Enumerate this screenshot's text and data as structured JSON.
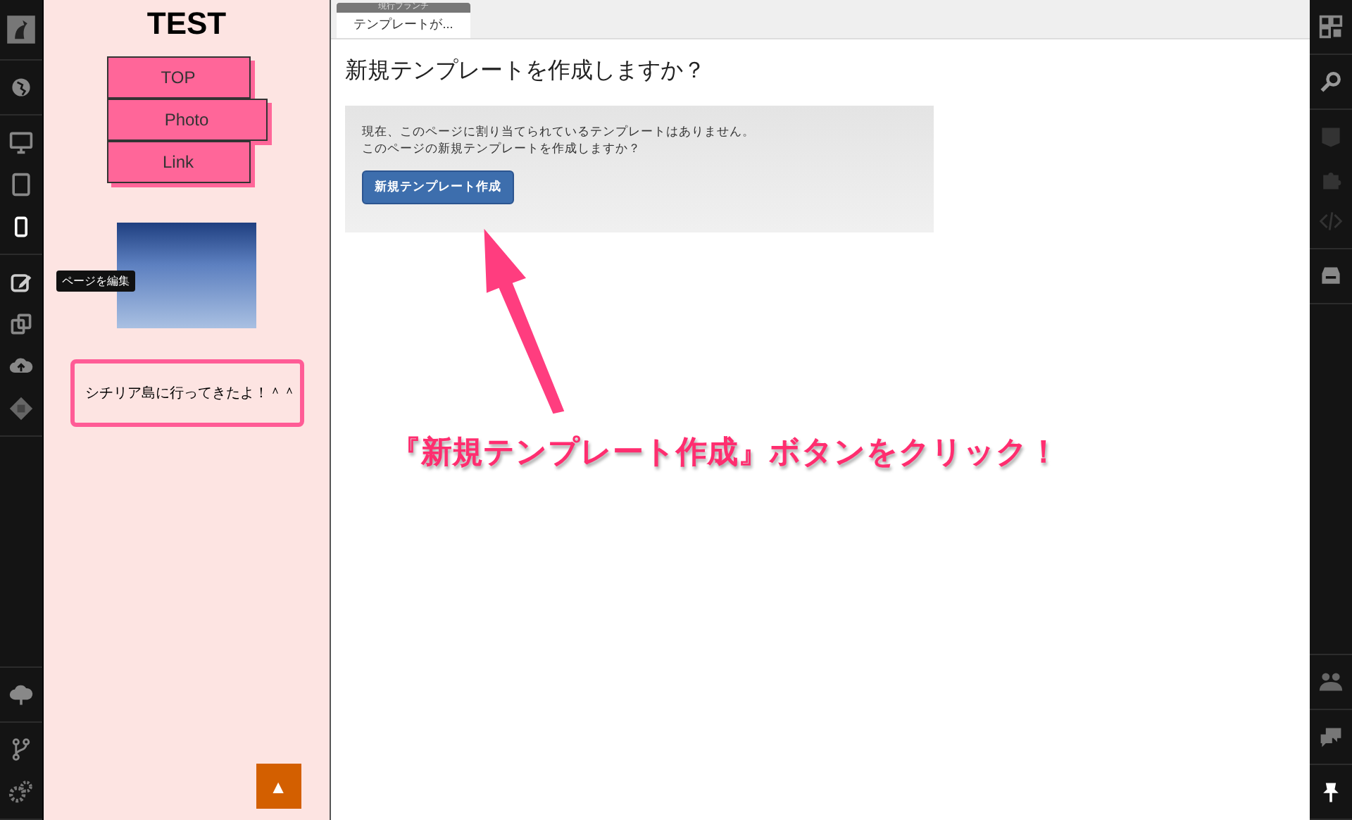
{
  "left_toolbar": {
    "devices": [
      {
        "selected": false
      },
      {
        "selected": false
      },
      {
        "selected": true
      }
    ],
    "tooltip": "ページを編集"
  },
  "preview": {
    "title": "TEST",
    "nav": [
      "TOP",
      "Photo",
      "Link"
    ],
    "caption": "シチリア島に行ってきたよ！＾＾",
    "scroll_top": "▲"
  },
  "tab": {
    "badge": "現行ブランチ",
    "label": "テンプレートが..."
  },
  "main": {
    "heading": "新規テンプレートを作成しますか？",
    "message": [
      "現在、このページに割り当てられているテンプレートはありません。",
      "このページの新規テンプレートを作成しますか？"
    ],
    "button": "新規テンプレート作成",
    "annotation": "『新規テンプレート作成』ボタンをクリック！"
  }
}
